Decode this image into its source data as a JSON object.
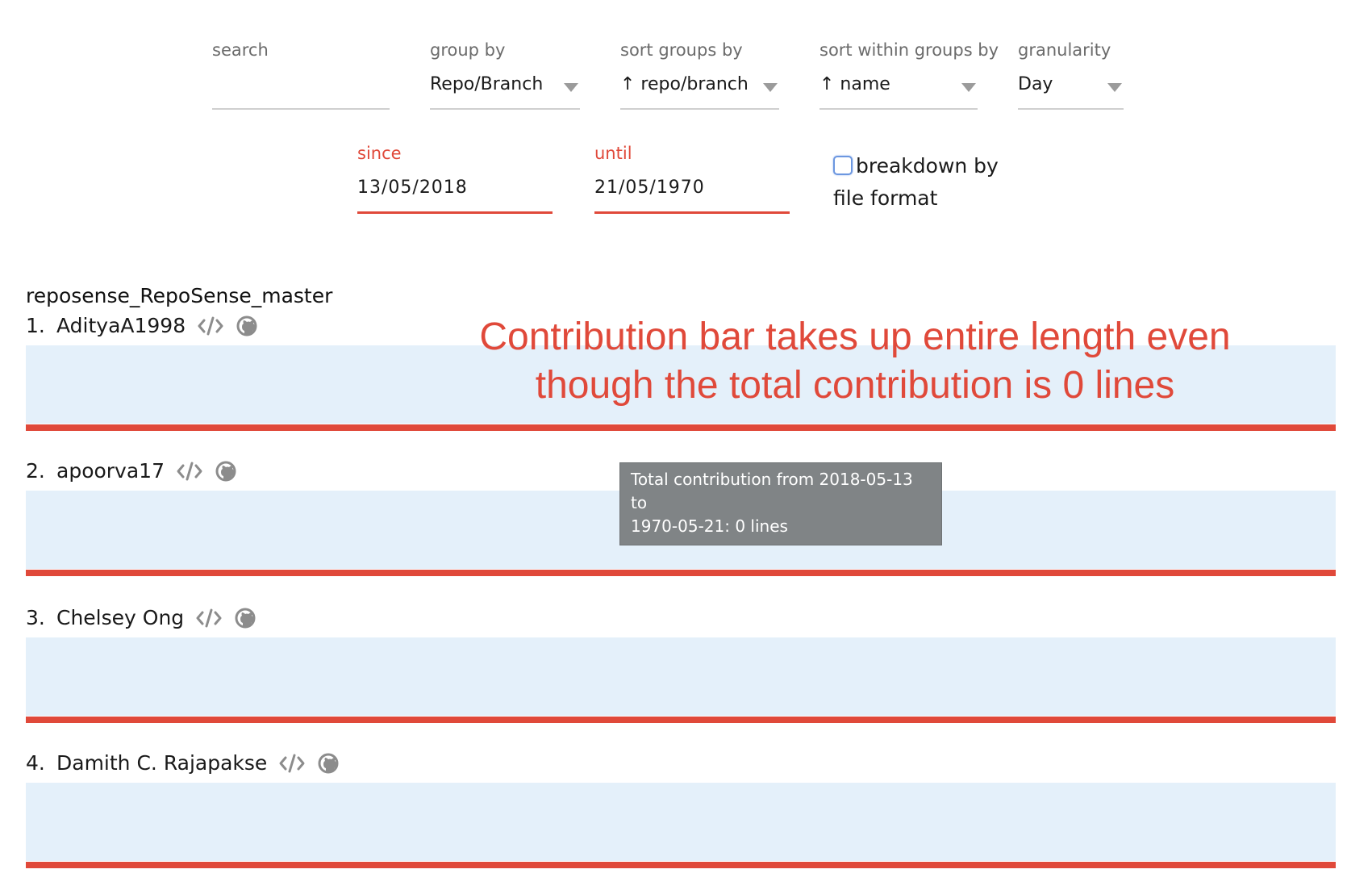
{
  "filters": {
    "search": {
      "label": "search",
      "value": ""
    },
    "group_by": {
      "label": "group by",
      "value": "Repo/Branch"
    },
    "sort_groups_by": {
      "label": "sort groups by",
      "value": "↑ repo/branch"
    },
    "sort_within_groups_by": {
      "label": "sort within groups by",
      "value": "↑ name"
    },
    "granularity": {
      "label": "granularity",
      "value": "Day"
    },
    "since": {
      "label": "since",
      "value": "13/05/2018"
    },
    "until": {
      "label": "until",
      "value": "21/05/1970"
    },
    "breakdown": {
      "label_line1": "breakdown by",
      "label_line2": "file format",
      "checked": false
    }
  },
  "repo": {
    "title": "reposense_RepoSense_master",
    "authors": [
      {
        "index": "1.",
        "name": "AdityaA1998",
        "contribution_fraction": 1.0
      },
      {
        "index": "2.",
        "name": "apoorva17",
        "contribution_fraction": 1.0
      },
      {
        "index": "3.",
        "name": "Chelsey Ong",
        "contribution_fraction": 1.0
      },
      {
        "index": "4.",
        "name": "Damith C. Rajapakse",
        "contribution_fraction": 1.0
      }
    ]
  },
  "annotation": {
    "line1": "Contribution bar takes up entire length even",
    "line2": "though the total contribution is 0 lines"
  },
  "tooltip": {
    "line1": "Total contribution from 2018-05-13 to",
    "line2": "1970-05-21: 0 lines"
  },
  "icons": {
    "code": "code-icon",
    "github": "github-icon"
  },
  "colors": {
    "accent": "#e0493a",
    "bar_background": "#e4f0fa",
    "tooltip_background": "#808486"
  }
}
